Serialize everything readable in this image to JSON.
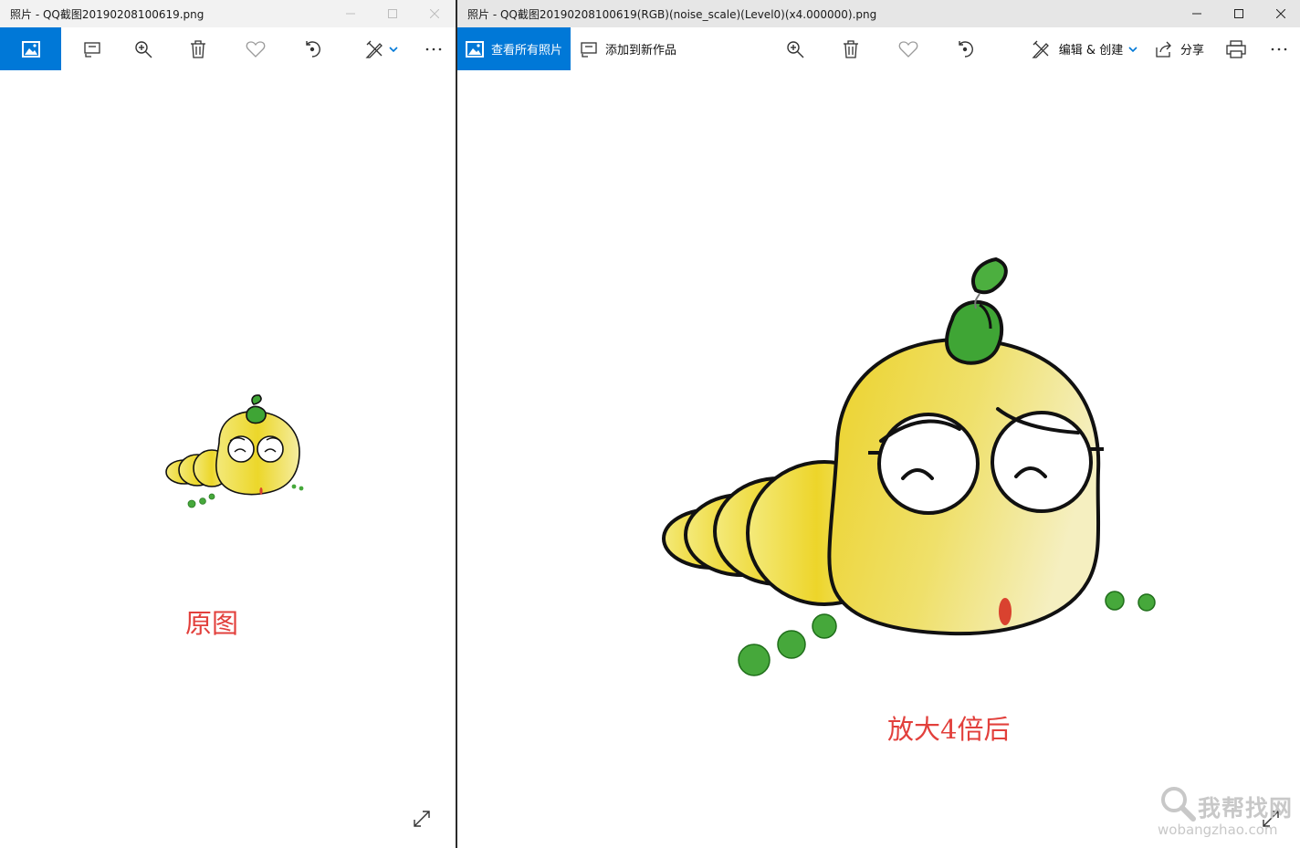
{
  "left_window": {
    "title": "照片 - QQ截图20190208100619.png",
    "caption": "原图",
    "toolbar": [
      {
        "icon": "photo-collection-icon",
        "label": ""
      },
      {
        "icon": "add-to-creation-icon",
        "label": ""
      },
      {
        "icon": "zoom-in-icon",
        "label": ""
      },
      {
        "icon": "delete-icon",
        "label": ""
      },
      {
        "icon": "favorite-heart-icon",
        "label": ""
      },
      {
        "icon": "rotate-icon",
        "label": ""
      },
      {
        "icon": "edit-create-icon",
        "label": ""
      },
      {
        "icon": "more-icon",
        "label": ""
      }
    ]
  },
  "right_window": {
    "title": "照片 - QQ截图20190208100619(RGB)(noise_scale)(Level0)(x4.000000).png",
    "caption": "放大4倍后",
    "toolbar": {
      "view_all": "查看所有照片",
      "add_to_creation": "添加到新作品",
      "edit_create": "编辑 & 创建",
      "share": "分享"
    }
  },
  "watermark": {
    "text": "我帮找网",
    "url": "wobangzhao.com"
  },
  "colors": {
    "accent": "#0078d7",
    "caption_red": "#e2403c",
    "worm_yellow": "#f0dc3a",
    "leaf_green": "#3fa535"
  }
}
